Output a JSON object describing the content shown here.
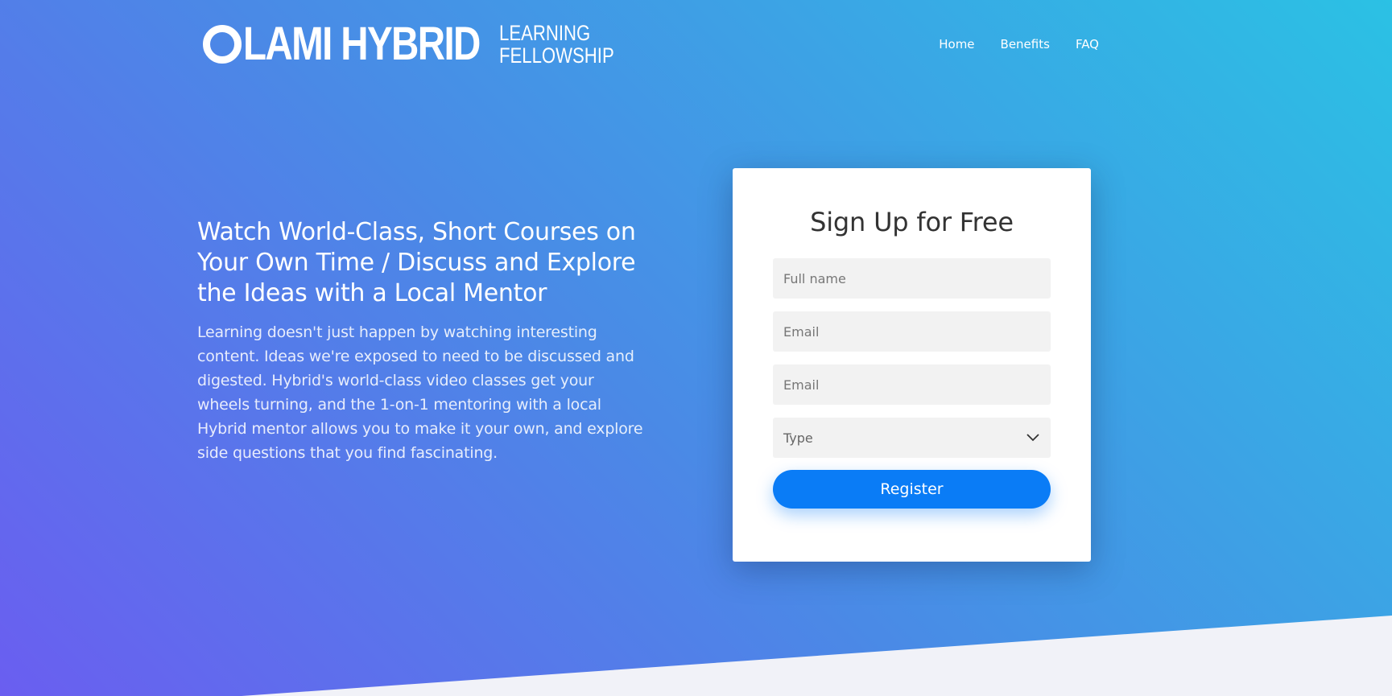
{
  "header": {
    "logo": {
      "main": "LAMI HYBRID",
      "sub_line1": "LEARNING",
      "sub_line2": "FELLOWSHIP"
    },
    "nav": [
      {
        "label": "Home"
      },
      {
        "label": "Benefits"
      },
      {
        "label": "FAQ"
      }
    ]
  },
  "hero": {
    "title": "Watch World-Class, Short Courses on Your Own Time / Discuss and Explore the Ideas with a Local Mentor",
    "body": "Learning doesn't just happen by watching interesting content. Ideas we're exposed to need to be discussed and digested. Hybrid's world-class video classes get your wheels turning, and the 1-on-1 mentoring with a local Hybrid mentor allows you to make it your own, and explore side questions that you find fascinating."
  },
  "form": {
    "title": "Sign Up for Free",
    "full_name_placeholder": "Full name",
    "email_placeholder": "Email",
    "email2_placeholder": "Email",
    "type_selected": "Type",
    "register_label": "Register"
  },
  "colors": {
    "gradient_start": "#6a5ef0",
    "gradient_end": "#2bc1e4",
    "button": "#0a7cf6",
    "wedge": "#f1f2f8"
  }
}
